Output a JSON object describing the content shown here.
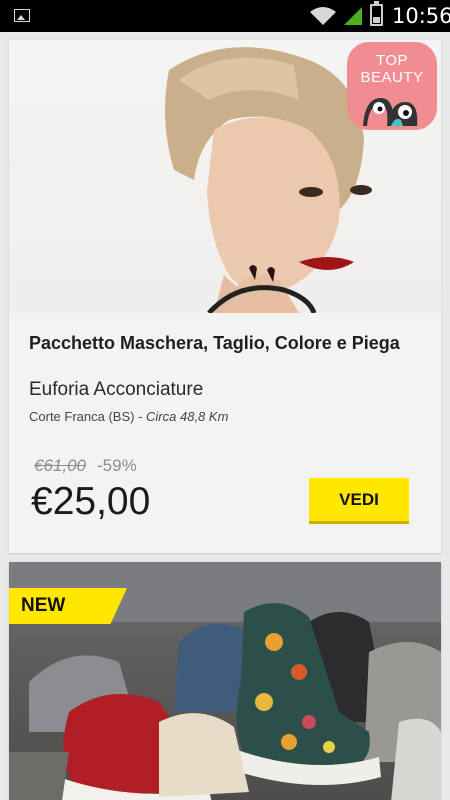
{
  "status_bar": {
    "time": "10:56",
    "icons": [
      "gallery-icon",
      "wifi-icon",
      "signal-icon",
      "battery-icon"
    ]
  },
  "deals": [
    {
      "badge": {
        "line1": "TOP",
        "line2": "BEAUTY",
        "color": "#f08c92"
      },
      "title": "Pacchetto Maschera, Taglio, Colore e Piega",
      "merchant": "Euforia Acconciature",
      "location": "Corte Franca (BS) - ",
      "distance": "Circa 48,8 Km",
      "old_price": "€61,00",
      "discount": "-59%",
      "price": "€25,00",
      "button_label": "VEDI"
    },
    {
      "badge_label": "NEW"
    }
  ],
  "colors": {
    "accent": "#ffe700",
    "badge_pink": "#f08c92"
  }
}
